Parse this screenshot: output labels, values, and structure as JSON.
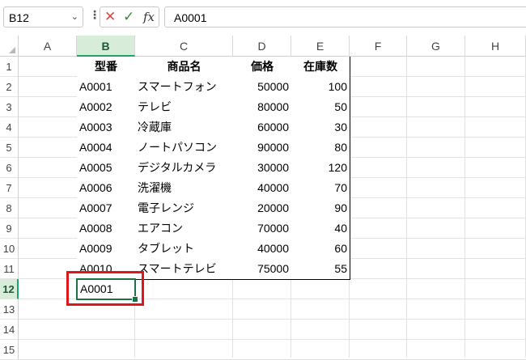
{
  "formula_bar": {
    "name_box": "B12",
    "name_box_arrow": "⌄",
    "more_icon": "⋮",
    "cancel_icon": "✕",
    "enter_icon": "✓",
    "fx_label": "fx",
    "formula": "A0001"
  },
  "columns": [
    "A",
    "B",
    "C",
    "D",
    "E",
    "F",
    "G",
    "H"
  ],
  "rows": [
    "1",
    "2",
    "3",
    "4",
    "5",
    "6",
    "7",
    "8",
    "9",
    "10",
    "11",
    "12",
    "13",
    "14",
    "15"
  ],
  "selected_column": "B",
  "selected_row": "12",
  "table": {
    "headers": [
      "型番",
      "商品名",
      "価格",
      "在庫数"
    ],
    "rows": [
      [
        "A0001",
        "スマートフォン",
        "50000",
        "100"
      ],
      [
        "A0002",
        "テレビ",
        "80000",
        "50"
      ],
      [
        "A0003",
        "冷蔵庫",
        "60000",
        "30"
      ],
      [
        "A0004",
        "ノートパソコン",
        "90000",
        "80"
      ],
      [
        "A0005",
        "デジタルカメラ",
        "30000",
        "120"
      ],
      [
        "A0006",
        "洗濯機",
        "40000",
        "70"
      ],
      [
        "A0007",
        "電子レンジ",
        "20000",
        "90"
      ],
      [
        "A0008",
        "エアコン",
        "70000",
        "40"
      ],
      [
        "A0009",
        "タブレット",
        "40000",
        "60"
      ],
      [
        "A0010",
        "スマートテレビ",
        "75000",
        "55"
      ]
    ]
  },
  "active_cell": {
    "ref": "B12",
    "value": "A0001"
  },
  "highlight_color": "#e0161d",
  "accent_color": "#21a366"
}
